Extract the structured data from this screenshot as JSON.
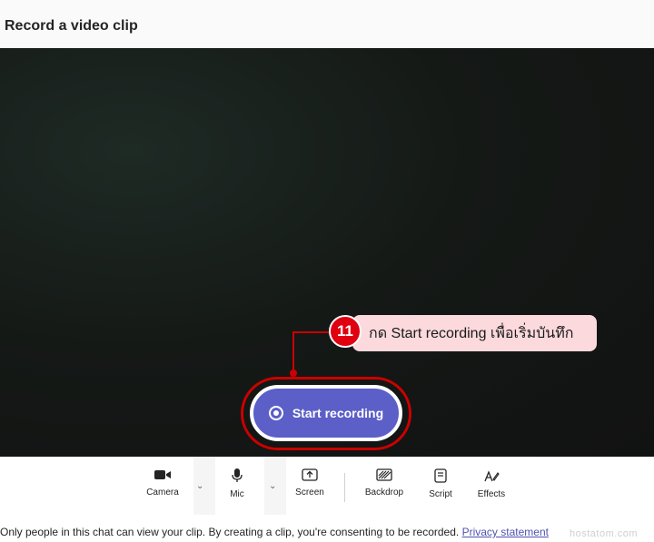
{
  "header": {
    "title": "Record a video clip"
  },
  "annotation": {
    "step": "11",
    "text": "กด Start recording เพื่อเริ่มบันทึก",
    "color": "#e0000f"
  },
  "record": {
    "label": "Start recording",
    "color": "#5b5fc7"
  },
  "toolbar": {
    "camera": "Camera",
    "mic": "Mic",
    "screen": "Screen",
    "backdrop": "Backdrop",
    "script": "Script",
    "effects": "Effects"
  },
  "footer": {
    "notice": "Only people in this chat can view your clip. By creating a clip, you're consenting to be recorded.",
    "link": "Privacy statement"
  },
  "watermark": "hostatom.com"
}
